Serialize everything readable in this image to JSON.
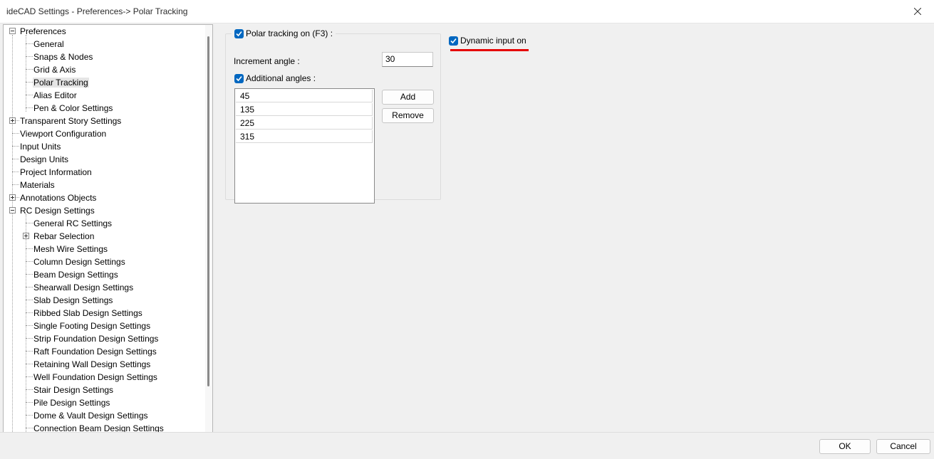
{
  "window": {
    "title": "ideCAD Settings - Preferences-> Polar Tracking"
  },
  "tree": {
    "items": [
      {
        "label": "Preferences"
      },
      {
        "label": "General"
      },
      {
        "label": "Snaps & Nodes"
      },
      {
        "label": "Grid & Axis"
      },
      {
        "label": "Polar Tracking"
      },
      {
        "label": "Alias Editor"
      },
      {
        "label": "Pen & Color Settings"
      },
      {
        "label": "Transparent Story Settings"
      },
      {
        "label": "Viewport Configuration"
      },
      {
        "label": "Input Units"
      },
      {
        "label": "Design Units"
      },
      {
        "label": "Project Information"
      },
      {
        "label": "Materials"
      },
      {
        "label": "Annotations Objects"
      },
      {
        "label": "RC Design Settings"
      },
      {
        "label": "General RC Settings"
      },
      {
        "label": "Rebar Selection"
      },
      {
        "label": "Mesh Wire Settings"
      },
      {
        "label": "Column Design Settings"
      },
      {
        "label": "Beam Design Settings"
      },
      {
        "label": "Shearwall Design Settings"
      },
      {
        "label": "Slab Design Settings"
      },
      {
        "label": "Ribbed Slab Design Settings"
      },
      {
        "label": "Single Footing Design Settings"
      },
      {
        "label": "Strip Foundation Design Settings"
      },
      {
        "label": "Raft Foundation Design Settings"
      },
      {
        "label": "Retaining Wall Design Settings"
      },
      {
        "label": "Well Foundation Design Settings"
      },
      {
        "label": "Stair Design Settings"
      },
      {
        "label": "Pile Design Settings"
      },
      {
        "label": "Dome & Vault Design Settings"
      },
      {
        "label": "Connection Beam Design Settings"
      }
    ]
  },
  "polar": {
    "enabled_label": "Polar tracking on (F3) :",
    "increment_label": "Increment angle :",
    "increment_value": "30",
    "additional_label": "Additional angles :",
    "angles": [
      "45",
      "135",
      "225",
      "315"
    ],
    "add_button": "Add",
    "remove_button": "Remove"
  },
  "dynamic_input": {
    "label": "Dynamic input on",
    "checked": true
  },
  "colors": {
    "accent": "#0067c0",
    "highlight": "#e60000"
  },
  "footer": {
    "ok": "OK",
    "cancel": "Cancel"
  }
}
